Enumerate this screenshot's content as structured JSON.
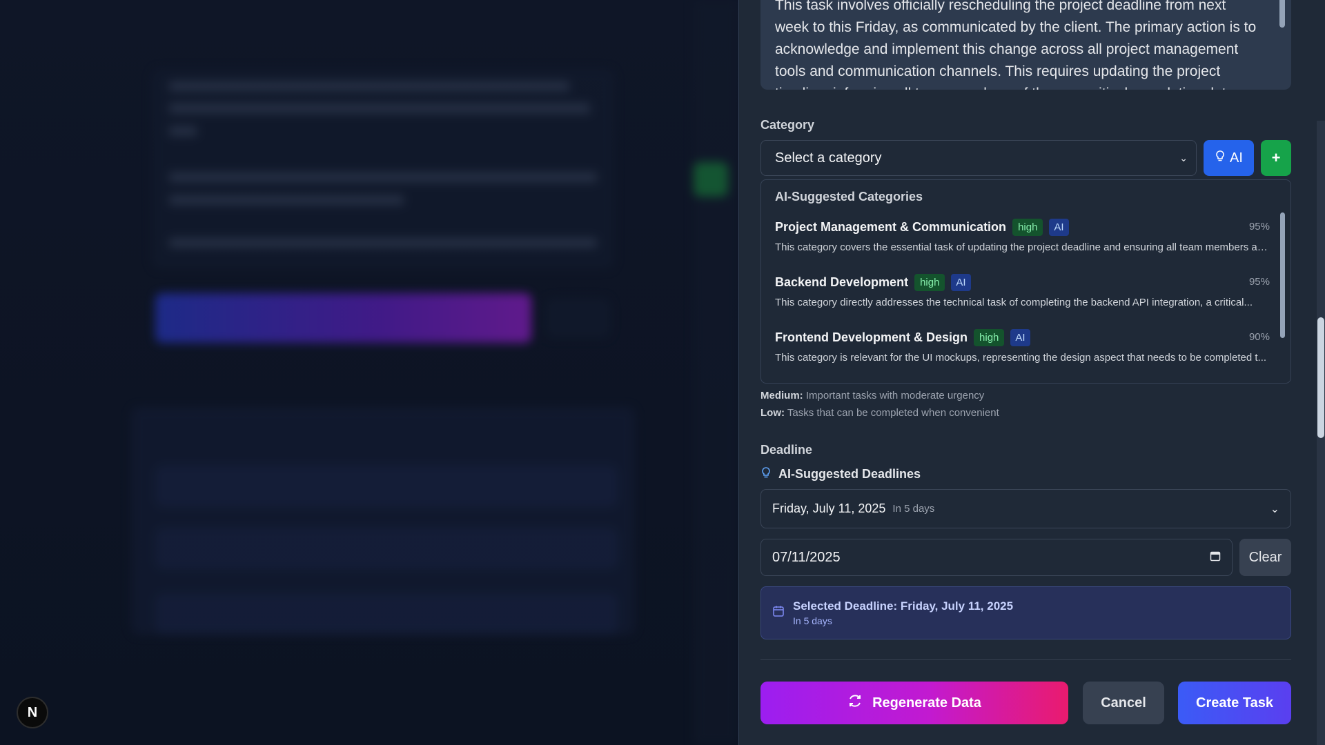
{
  "description": {
    "text": "This task involves officially rescheduling the project deadline from next week to this Friday, as communicated by the client. The primary action is to acknowledge and implement this change across all project management tools and communication channels. This requires updating the project timeline, informing all team members of the new critical completion date, and potentially re-"
  },
  "category": {
    "label": "Category",
    "placeholder": "Select a category",
    "ai_button_label": "AI",
    "add_button_label": "+"
  },
  "ai_suggestions": {
    "title": "AI-Suggested Categories",
    "items": [
      {
        "name": "Project Management & Communication",
        "priority": "high",
        "tag": "AI",
        "confidence": "95%",
        "description": "This category covers the essential task of updating the project deadline and ensuring all team members ar..."
      },
      {
        "name": "Backend Development",
        "priority": "high",
        "tag": "AI",
        "confidence": "95%",
        "description": "This category directly addresses the technical task of completing the backend API integration, a critical..."
      },
      {
        "name": "Frontend Development & Design",
        "priority": "high",
        "tag": "AI",
        "confidence": "90%",
        "description": "This category is relevant for the UI mockups, representing the design aspect that needs to be completed t..."
      }
    ]
  },
  "priority_help": {
    "medium_label": "Medium:",
    "medium_text": "Important tasks with moderate urgency",
    "low_label": "Low:",
    "low_text": "Tasks that can be completed when convenient"
  },
  "deadline": {
    "label": "Deadline",
    "ai_title": "AI-Suggested Deadlines",
    "suggested_date": "Friday, July 11, 2025",
    "suggested_relative": "In 5 days",
    "input_value": "07/11/2025",
    "clear_label": "Clear",
    "selected_title": "Selected Deadline: Friday, July 11, 2025",
    "selected_sub": "In 5 days"
  },
  "actions": {
    "regenerate_label": "Regenerate Data",
    "cancel_label": "Cancel",
    "create_label": "Create Task"
  },
  "badge": {
    "letter": "N"
  },
  "colors": {
    "ai_blue": "#2563eb",
    "add_green": "#16a34a",
    "regen_start": "#9c1ef0",
    "regen_end": "#ea1b6e",
    "create_start": "#3b5bf6"
  }
}
